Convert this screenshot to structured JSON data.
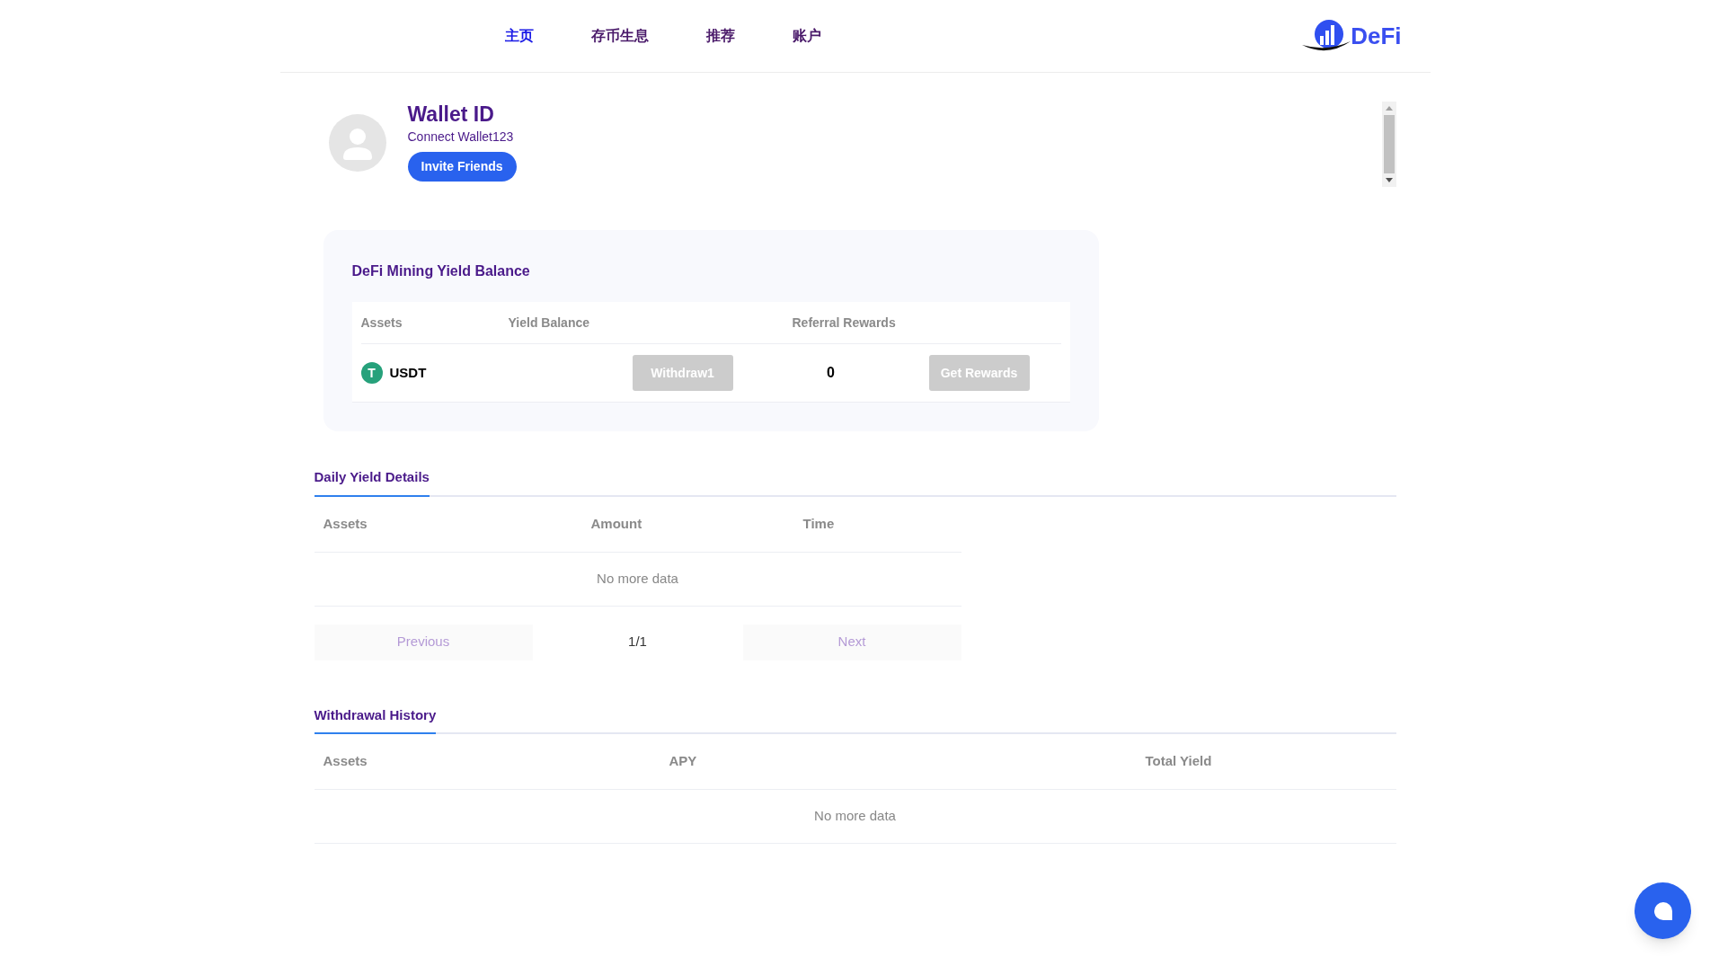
{
  "nav": [
    {
      "label": "主页",
      "selected": true
    },
    {
      "label": "存币生息",
      "selected": false
    },
    {
      "label": "推荐",
      "selected": false
    },
    {
      "label": "账户",
      "selected": false
    }
  ],
  "logo": {
    "text": "DeFi"
  },
  "profile": {
    "title": "Wallet ID",
    "subtitle": "Connect Wallet123",
    "button": "Invite Friends"
  },
  "balance": {
    "title": "DeFi Mining Yield Balance",
    "columns": [
      "Assets",
      "Yield Balance",
      "Referral Rewards"
    ],
    "rows": [
      {
        "asset": "USDT",
        "icon": "T",
        "withdraw": "Withdraw1",
        "rewards": "0",
        "action": "Get Rewards",
        "disabled": true
      }
    ]
  },
  "daily": {
    "tabs": [
      {
        "label": "Daily Yield Details",
        "selected": true
      }
    ],
    "columns": [
      "Assets",
      "Amount",
      "Time"
    ],
    "empty": "No more data",
    "pagination": {
      "previous": "Previous",
      "page": "1/1",
      "next": "Next"
    }
  },
  "withdrawals": {
    "tabs": [
      {
        "label": "Withdrawal History",
        "selected": true
      }
    ],
    "columns": [
      "Assets",
      "APY",
      "Total Yield"
    ],
    "empty": "No more data"
  }
}
